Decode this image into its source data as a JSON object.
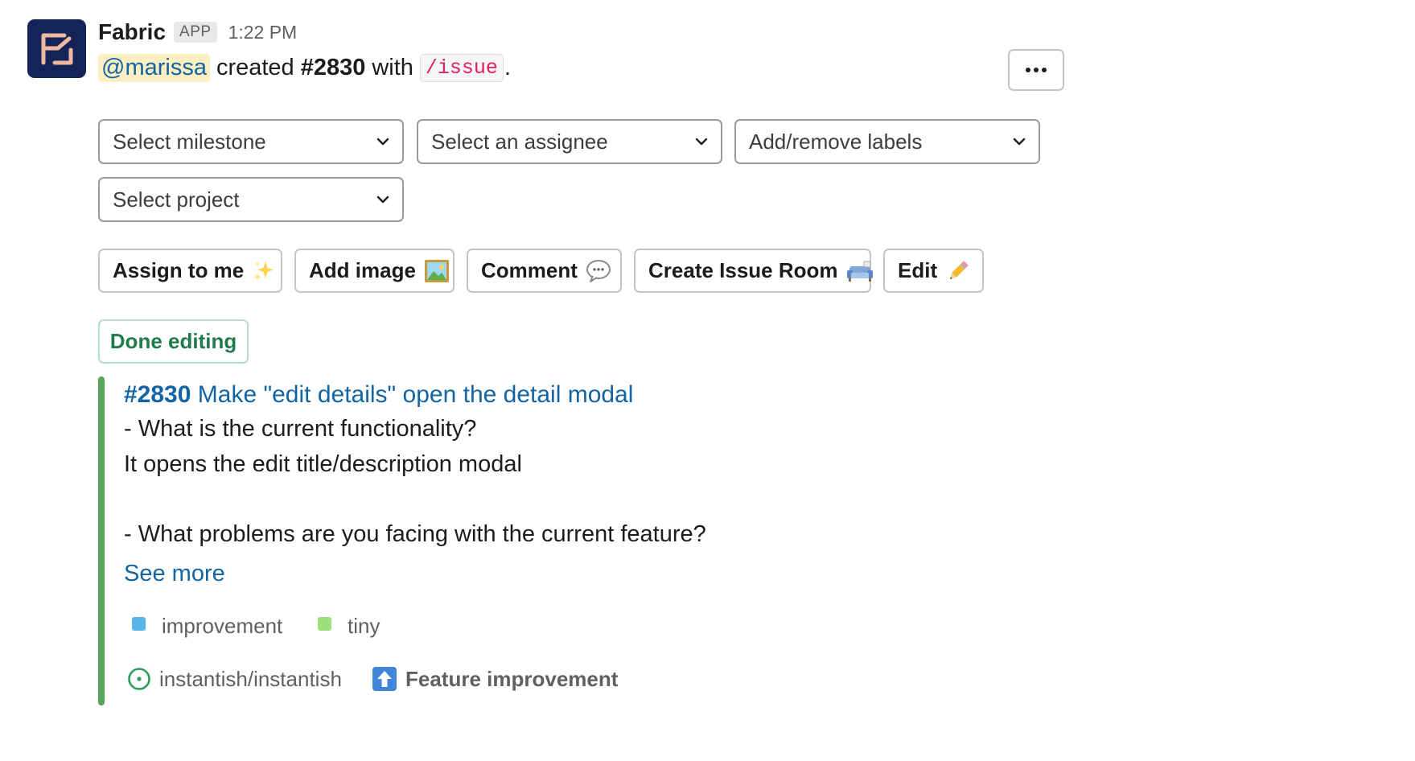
{
  "app": {
    "name": "Fabric",
    "badge": "APP",
    "timestamp": "1:22 PM",
    "logo_color": "#14245a",
    "logo_accent": "#f0b8a0"
  },
  "message": {
    "mention": "@marissa",
    "text_created": "created",
    "issue_ref": "#2830",
    "text_with": "with",
    "command": "/issue",
    "period": "."
  },
  "more_button": {
    "icon": "more-horizontal-icon",
    "label": "•••"
  },
  "selects": {
    "milestone": "Select milestone",
    "assignee": "Select an assignee",
    "labels": "Add/remove labels",
    "project": "Select project"
  },
  "actions": {
    "assign": {
      "label": "Assign to me",
      "emoji": "sparkles-icon"
    },
    "add_image": {
      "label": "Add image",
      "emoji": "framed-picture-icon"
    },
    "comment": {
      "label": "Comment",
      "emoji": "speech-balloon-icon"
    },
    "room": {
      "label": "Create Issue Room",
      "emoji": "couch-icon"
    },
    "edit": {
      "label": "Edit",
      "emoji": "pencil-icon"
    }
  },
  "done_editing": "Done editing",
  "issue": {
    "number": "#2830",
    "title": "Make \"edit details\" open the detail modal",
    "lines": [
      "- What is the current functionality?",
      "It opens the edit title/description modal",
      "",
      "- What problems are you facing with the current feature?"
    ],
    "see_more": "See more",
    "accent_color": "#56a558"
  },
  "labels": [
    {
      "name": "improvement",
      "color": "#5ab4e8"
    },
    {
      "name": "tiny",
      "color": "#9be07a"
    }
  ],
  "footer": {
    "repo": "instantish/instantish",
    "repo_icon": "issue-open-icon",
    "repo_icon_color": "#2d9c5c",
    "type_icon": "up-arrow-icon",
    "type": "Feature improvement"
  }
}
